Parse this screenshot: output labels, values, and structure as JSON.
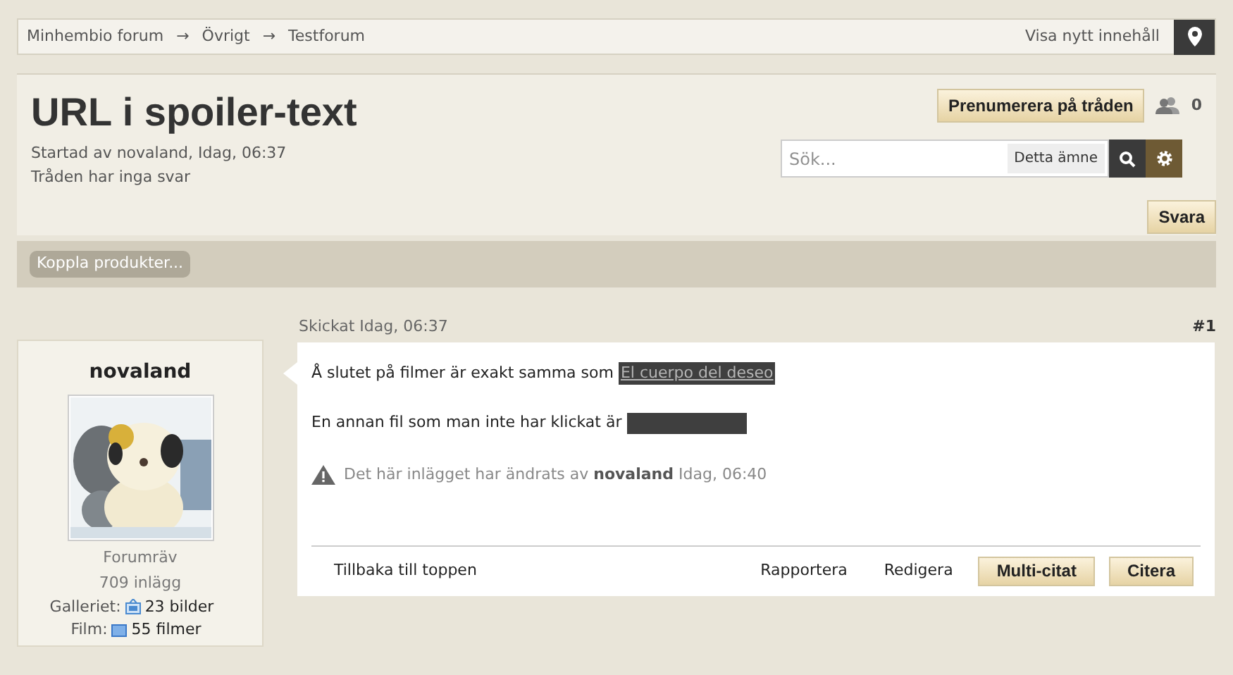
{
  "breadcrumb": {
    "items": [
      "Minhembio forum",
      "Övrigt",
      "Testforum"
    ],
    "separator": "→",
    "new_content_link": "Visa nytt innehåll"
  },
  "thread": {
    "title": "URL i spoiler-text",
    "started": "Startad av novaland, Idag, 06:37",
    "replies": "Tråden har inga svar",
    "subscribe_button": "Prenumerera på tråden",
    "followers": "0"
  },
  "search": {
    "placeholder": "Sök...",
    "scope": "Detta ämne"
  },
  "reply_button": "Svara",
  "tag_button": "Koppla produkter...",
  "post": {
    "sent": "Skickat Idag, 06:37",
    "number": "#1",
    "author": {
      "name": "novaland",
      "rank": "Forumräv",
      "posts": "709 inlägg",
      "gallery_label": "Galleriet:",
      "gallery": "23 bilder",
      "film_label": "Film:",
      "film": "55 filmer"
    },
    "paragraphs": [
      {
        "text": "Å slutet på filmer är exakt samma som",
        "spoiler": {
          "text": "El cuerpo del deseo",
          "revealed": true
        }
      },
      {
        "text": "En annan fil som man inte har klickat är",
        "spoiler": {
          "revealed": false
        }
      }
    ],
    "edit_note": "Det här inlägget har ändrats av **novaland** Idag, 06:40",
    "back_to_top": "Tillbaka till toppen",
    "actions": [
      {
        "label": "Rapportera",
        "kind": "link"
      },
      {
        "label": "Redigera",
        "kind": "link"
      },
      {
        "label": "Multi-citat",
        "kind": "button"
      },
      {
        "label": "Citera",
        "kind": "button"
      }
    ]
  }
}
